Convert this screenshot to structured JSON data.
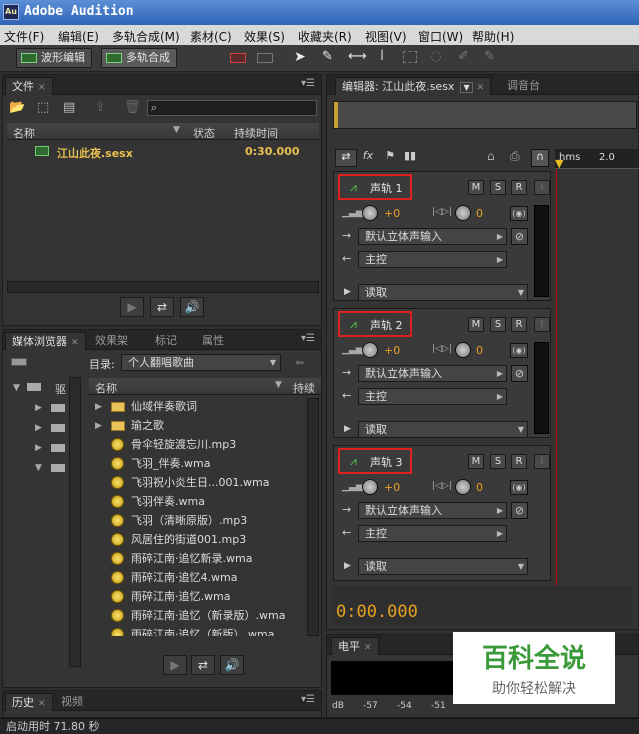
{
  "app": {
    "title": "Adobe Audition",
    "logo": "Au"
  },
  "menu": [
    "文件(F)",
    "编辑(E)",
    "多轨合成(M)",
    "素材(C)",
    "效果(S)",
    "收藏夹(R)",
    "视图(V)",
    "窗口(W)",
    "帮助(H)"
  ],
  "toolbar": {
    "waveform": "波形编辑",
    "multitrack": "多轨合成"
  },
  "files": {
    "tab": "文件",
    "cols": [
      "名称",
      "状态",
      "持续时间"
    ],
    "item": {
      "name": "江山此夜.sesx",
      "duration": "0:30.000"
    }
  },
  "media": {
    "tabs": [
      "媒体浏览器",
      "效果架",
      "标记",
      "属性"
    ],
    "dir_label": "目录:",
    "dir_value": "个人翻唱歌曲",
    "col_name": "名称",
    "col_dur": "持续",
    "drive_label": "驱",
    "items": [
      {
        "name": "仙域伴奏歌词",
        "type": "folder"
      },
      {
        "name": "瑜之歌",
        "type": "folder"
      },
      {
        "name": "骨伞轻旋渡忘川.mp3",
        "type": "file"
      },
      {
        "name": "飞羽_伴奏.wma",
        "type": "file"
      },
      {
        "name": "飞羽祝小炎生日...001.wma",
        "type": "file"
      },
      {
        "name": "飞羽伴奏.wma",
        "type": "file"
      },
      {
        "name": "飞羽（清晰原版）.mp3",
        "type": "file"
      },
      {
        "name": "风居住的街道001.mp3",
        "type": "file"
      },
      {
        "name": "雨碎江南·追忆新录.wma",
        "type": "file"
      },
      {
        "name": "雨碎江南·追忆4.wma",
        "type": "file"
      },
      {
        "name": "雨碎江南·追忆.wma",
        "type": "file"
      },
      {
        "name": "雨碎江南·追忆（新录版）.wma",
        "type": "file"
      },
      {
        "name": "雨碎江南·追忆（新版）.wma",
        "type": "file"
      }
    ]
  },
  "history": {
    "tabs": [
      "历史",
      "视频"
    ]
  },
  "status": "启动用时 71.80 秒",
  "editor": {
    "tab": "编辑器: 江山此夜.sesx",
    "mixer": "调音台",
    "ruler": {
      "unit": "hms",
      "mark": "2.0"
    },
    "time": "0:00.000"
  },
  "tracks": [
    {
      "name": "声轨 1",
      "vol": "+0",
      "pan": "0",
      "input": "默认立体声输入",
      "output": "主控",
      "mode": "读取"
    },
    {
      "name": "声轨 2",
      "vol": "+0",
      "pan": "0",
      "input": "默认立体声输入",
      "output": "主控",
      "mode": "读取"
    },
    {
      "name": "声轨 3",
      "vol": "+0",
      "pan": "0",
      "input": "默认立体声输入",
      "output": "主控",
      "mode": "读取"
    }
  ],
  "track_buttons": {
    "m": "M",
    "s": "S",
    "r": "R",
    "i": "I"
  },
  "levels": {
    "tab": "电平",
    "unit": "dB",
    "ticks": [
      "-57",
      "-54",
      "-51"
    ]
  },
  "watermark": {
    "line1": "百科全说",
    "line2": "助你轻松解决"
  },
  "colors": {
    "accent": "#e8a020",
    "record_outline": "#e02020",
    "playhead": "#c00000"
  }
}
